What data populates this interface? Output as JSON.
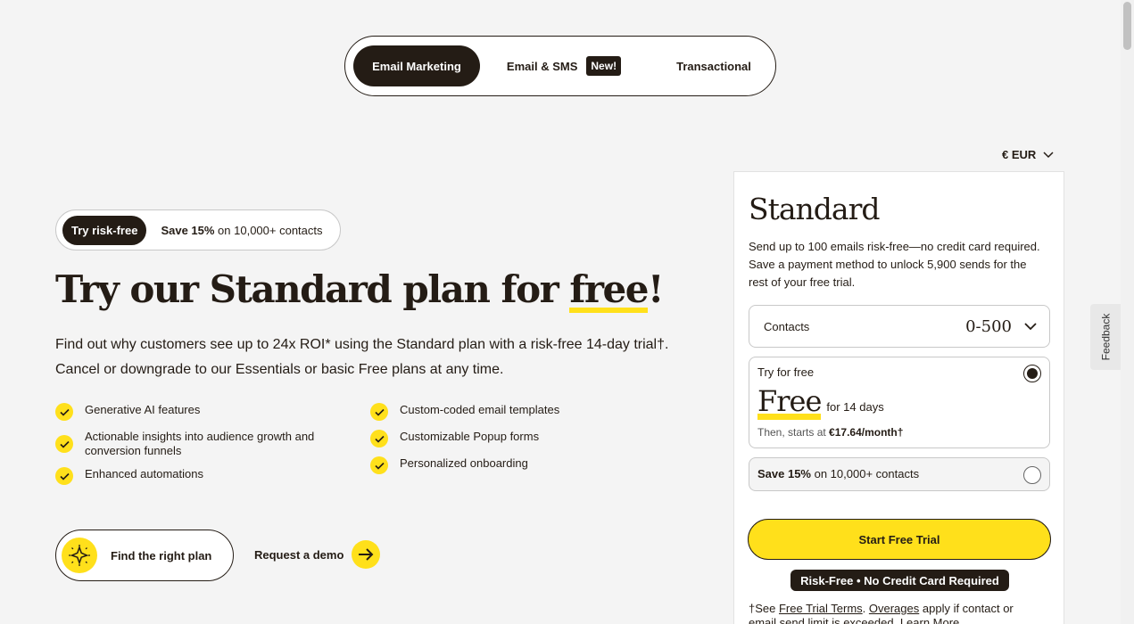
{
  "tabs": {
    "email_marketing": "Email Marketing",
    "email_sms": "Email & SMS",
    "new_badge": "New!",
    "transactional": "Transactional"
  },
  "currency": "€ EUR",
  "promo": {
    "tag": "Try risk-free",
    "save_bold": "Save 15%",
    "save_rest": " on 10,000+ contacts"
  },
  "headline": {
    "prefix": "Try our Standard plan for ",
    "highlight": "free",
    "suffix": "!"
  },
  "description": "Find out why customers see up to 24x ROI* using the Standard plan with a risk-free 14-day trial†. Cancel or downgrade to our Essentials or basic Free plans at any time.",
  "features": [
    "Generative AI features",
    "Actionable insights into audience growth and conversion funnels",
    "Enhanced automations",
    "Custom-coded email templates",
    "Customizable Popup forms",
    "Personalized onboarding"
  ],
  "cta": {
    "find_plan": "Find the right plan",
    "request_demo": "Request a demo"
  },
  "card": {
    "title": "Standard",
    "description": "Send up to 100 emails risk-free—no credit card required. Save a payment method to unlock 5,900 sends for the rest of your free trial.",
    "contacts_label": "Contacts",
    "contacts_value": "0-500",
    "option1": {
      "label": "Try for free",
      "price": "Free",
      "duration": "for 14 days",
      "then_prefix": "Then, starts at ",
      "then_price": "€17.64/month†"
    },
    "option2": {
      "bold": "Save 15%",
      "rest": " on 10,000+ contacts"
    },
    "start_button": "Start Free Trial",
    "risk_badge": "Risk-Free • No Credit Card Required",
    "footnote": {
      "pre": "†See ",
      "link1": "Free Trial Terms",
      "mid1": ". ",
      "link2": "Overages",
      "mid2": " apply if contact or email send limit is exceeded. ",
      "link3": "Learn More"
    }
  },
  "feedback": "Feedback",
  "colors": {
    "brand_yellow": "#ffe01b",
    "dark": "#241c15",
    "background": "#f4f4f4"
  }
}
